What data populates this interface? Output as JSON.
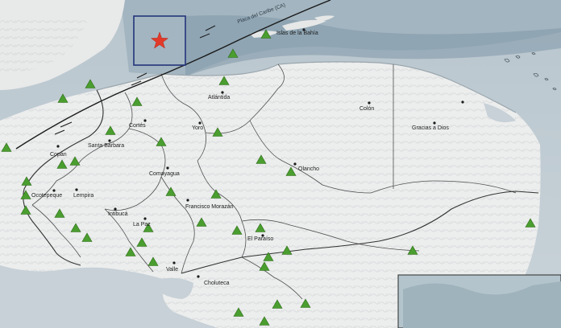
{
  "map": {
    "plate_label": "Placa del Caribe (CA)",
    "colors": {
      "sea": "#c6d1d8",
      "sea_deep": "#8fa6b3",
      "land": "#eceded",
      "border": "#555555",
      "fault": "#1a1a1a",
      "station": "#4a9e2f",
      "epicenter": "#e23a2a",
      "box": "#24357a"
    },
    "departments": [
      "Islas de la Bahía",
      "Atlántida",
      "Colón",
      "Cortés",
      "Yoro",
      "Gracias a Dios",
      "Copán",
      "Santa Bárbara",
      "Comayagua",
      "Olancho",
      "Ocotepeque",
      "Lempira",
      "Intibucá",
      "La Paz",
      "Francisco Morazán",
      "El Paraíso",
      "Valle",
      "Choluteca"
    ],
    "epicenter_icon": "red-star-icon",
    "station_icon": "green-triangle-icon"
  }
}
